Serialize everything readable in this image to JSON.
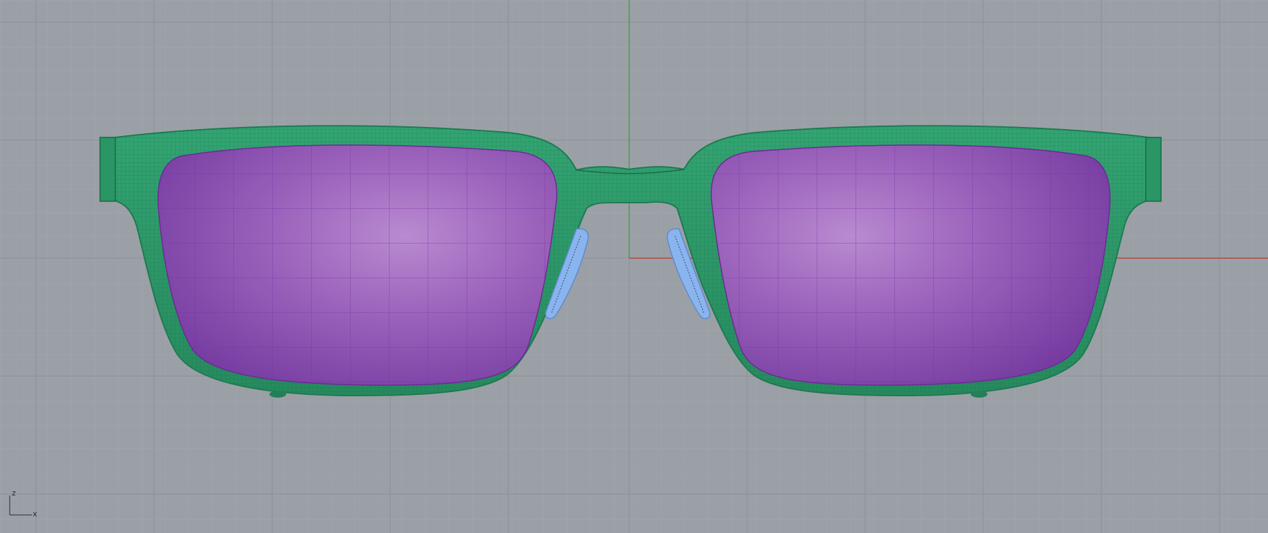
{
  "viewport": {
    "projection": "Front",
    "background_color": "#9ba0a6",
    "grid_minor_color": "#a3a8ae",
    "grid_major_color": "#8a8f95",
    "world_x_axis_color": "#b5483e",
    "world_z_axis_color": "#3fa24f"
  },
  "model": {
    "frame_color": "#2e9a6a",
    "frame_wire_color": "#1f7a52",
    "lens_color": "#9a5fb8",
    "lens_wire_color": "#7a2fa0",
    "nose_pad_color": "#8ab4ee"
  },
  "axis_gizmo": {
    "vertical_label": "z",
    "horizontal_label": "x",
    "icon_name": "axis-gizmo-icon"
  }
}
